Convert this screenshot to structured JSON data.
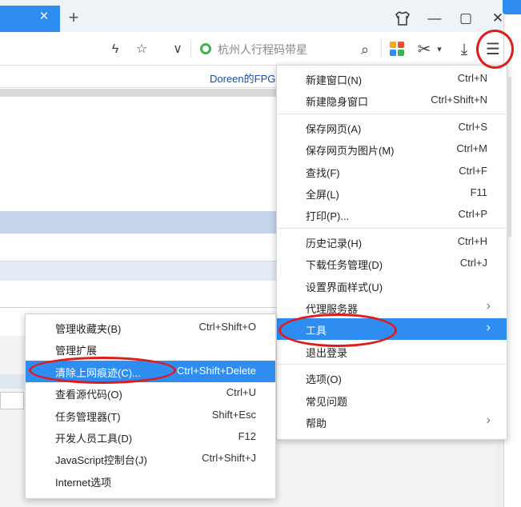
{
  "window": {
    "tab_close": "×",
    "new_tab": "+",
    "shirt_icon": "shirt-icon",
    "minimize": "—",
    "maximize": "▢",
    "close": "✕"
  },
  "toolbar": {
    "lightning": "ϟ",
    "star": "☆",
    "dropdown": "∨",
    "search_text": "杭州人行程码带星",
    "search_icon": "⌕",
    "scissors": "✂",
    "scissors_dd": "▾",
    "download": "⤓",
    "menu": "☰"
  },
  "bookmarks": {
    "item": "Doreen的FPG"
  },
  "main_menu": {
    "groups": [
      [
        {
          "label": "新建窗口(N)",
          "shortcut": "Ctrl+N"
        },
        {
          "label": "新建隐身窗口",
          "shortcut": "Ctrl+Shift+N"
        }
      ],
      [
        {
          "label": "保存网页(A)",
          "shortcut": "Ctrl+S"
        },
        {
          "label": "保存网页为图片(M)",
          "shortcut": "Ctrl+M"
        },
        {
          "label": "查找(F)",
          "shortcut": "Ctrl+F"
        },
        {
          "label": "全屏(L)",
          "shortcut": "F11"
        },
        {
          "label": "打印(P)...",
          "shortcut": "Ctrl+P"
        }
      ],
      [
        {
          "label": "历史记录(H)",
          "shortcut": "Ctrl+H"
        },
        {
          "label": "下载任务管理(D)",
          "shortcut": "Ctrl+J"
        },
        {
          "label": "设置界面样式(U)",
          "shortcut": ""
        },
        {
          "label": "代理服务器",
          "shortcut": "",
          "arrow": "›"
        },
        {
          "label": "工具",
          "shortcut": "",
          "arrow": "›"
        },
        {
          "label": "退出登录",
          "shortcut": ""
        }
      ],
      [
        {
          "label": "选项(O)",
          "shortcut": ""
        },
        {
          "label": "常见问题",
          "shortcut": ""
        },
        {
          "label": "帮助",
          "shortcut": "",
          "arrow": "›"
        }
      ]
    ]
  },
  "tools_submenu": {
    "items": [
      {
        "label": "管理收藏夹(B)",
        "shortcut": "Ctrl+Shift+O"
      },
      {
        "label": "管理扩展",
        "shortcut": ""
      },
      {
        "label": "清除上网痕迹(C)...",
        "shortcut": "Ctrl+Shift+Delete"
      },
      {
        "label": "查看源代码(O)",
        "shortcut": "Ctrl+U"
      },
      {
        "label": "任务管理器(T)",
        "shortcut": "Shift+Esc"
      },
      {
        "label": "开发人员工具(D)",
        "shortcut": "F12"
      },
      {
        "label": "JavaScript控制台(J)",
        "shortcut": "Ctrl+Shift+J"
      },
      {
        "label": "Internet选项",
        "shortcut": ""
      }
    ]
  },
  "colors": {
    "accent": "#2f8cf0",
    "annotation": "#e01b1b"
  }
}
